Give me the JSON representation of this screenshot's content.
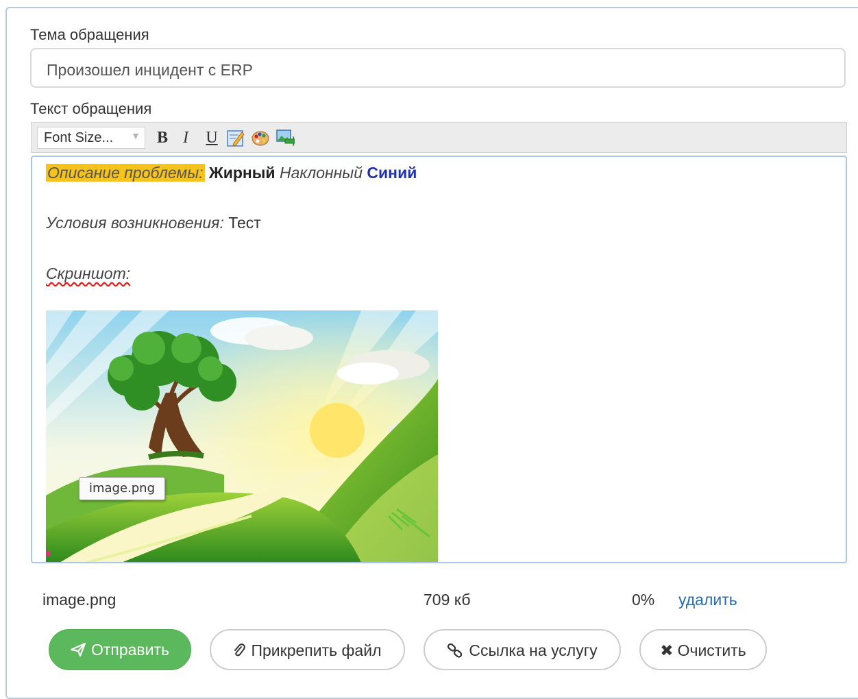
{
  "form": {
    "subject_label": "Тема обращения",
    "subject_value": "Произошел инцидент с ERP",
    "text_label": "Текст обращения"
  },
  "toolbar": {
    "font_size": "Font Size...",
    "bold": "B",
    "italic": "I",
    "underline": "U",
    "icons": [
      "edit-icon",
      "color-palette-icon",
      "insert-image-icon"
    ]
  },
  "editor": {
    "highlight_text": "Описание проблемы:",
    "bold_text": "Жирный",
    "italic_text": "Наклонный",
    "blue_text": "Синий",
    "blue_color": "#2233aa",
    "highlight_color": "#f6c21c",
    "conditions_label": "Условия возникновения:",
    "conditions_value": "Тест",
    "screenshot_label": "Скриншот:",
    "image_tooltip": "image.png"
  },
  "attachment": {
    "name": "image.png",
    "size": "709 кб",
    "progress": "0%",
    "delete_label": "удалить"
  },
  "buttons": {
    "send": "Отправить",
    "attach": "Прикрепить файл",
    "link": "Ссылка на услугу",
    "clear": "Очистить"
  },
  "colors": {
    "primary_button": "#5cb85c",
    "link": "#2a6bb0"
  }
}
